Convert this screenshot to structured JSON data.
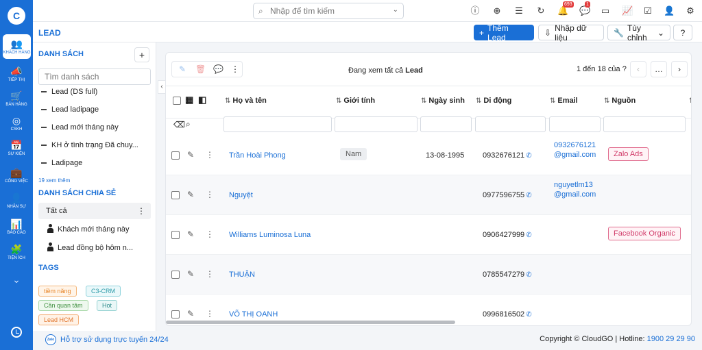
{
  "app": {
    "logo_letter": "C"
  },
  "rail": [
    {
      "label": "KHÁCH HÀNG",
      "icon": "👥"
    },
    {
      "label": "TIẾP THỊ",
      "icon": "📣"
    },
    {
      "label": "BÁN HÀNG",
      "icon": "🛒"
    },
    {
      "label": "CSKH",
      "icon": "◎"
    },
    {
      "label": "SỰ KIỆN",
      "icon": "📅"
    },
    {
      "label": "CÔNG VIỆC",
      "icon": "💼"
    },
    {
      "label": "NHÂN SỰ",
      "icon": "👤"
    },
    {
      "label": "BÁO CÁO",
      "icon": "📊"
    },
    {
      "label": "TIỆN ÍCH",
      "icon": "🧩"
    }
  ],
  "topbar": {
    "search_placeholder": "Nhập để tìm kiếm",
    "notifications_count": "693",
    "messages_count": "1"
  },
  "header": {
    "title": "LEAD",
    "add_button": "Thêm Lead",
    "import_button": "Nhập dữ liệu",
    "customize_button": "Tùy chỉnh"
  },
  "sidebar": {
    "list_title": "DANH SÁCH",
    "list_search_placeholder": "Tìm danh sách",
    "lists": [
      "Lead (DS full)",
      "Lead ladipage",
      "Lead mới tháng này",
      "KH ở tình trạng Đã chuy...",
      "Ladipage"
    ],
    "view_more": "19 xem thêm",
    "shared_title": "DANH SÁCH CHIA SẺ",
    "shared_all": "Tất cả",
    "shared_items": [
      "Khách mới tháng này",
      "Lead đồng bộ hôm n..."
    ],
    "tags_title": "TAGS",
    "tags": [
      {
        "label": "tiềm năng",
        "color": "#e8862a",
        "bg": "#fff4e8",
        "border": "#f4b77a"
      },
      {
        "label": "C3-CRM",
        "color": "#2b9aa8",
        "bg": "#eaf8fa",
        "border": "#8fd3dc"
      },
      {
        "label": "Cần quan tâm",
        "color": "#3f8f3f",
        "bg": "#eef8ee",
        "border": "#a7d8a7"
      },
      {
        "label": "Hot",
        "color": "#2b8a8a",
        "bg": "#eaf7f7",
        "border": "#95d2d2"
      },
      {
        "label": "Lead HCM",
        "color": "#e0732a",
        "bg": "#fff2e6",
        "border": "#f4b27e"
      }
    ]
  },
  "table": {
    "viewing_prefix": "Đang xem tất cả",
    "viewing_entity": "Lead",
    "pagination": "1 đến 18 của",
    "pagination_unknown": "?",
    "columns": [
      "Họ và tên",
      "Giới tính",
      "Ngày sinh",
      "Di động",
      "Email",
      "Nguồn"
    ],
    "rows": [
      {
        "name": "Trần Hoài Phong",
        "gender": "Nam",
        "dob": "13-08-1995",
        "mobile": "0932676121",
        "email": "0932676121@gmail.com",
        "source": "Zalo Ads"
      },
      {
        "name": "Nguyệt",
        "gender": "",
        "dob": "",
        "mobile": "0977596755",
        "email": "nguyetlm13@gmail.com",
        "source": ""
      },
      {
        "name": "Williams Luminosa Luna",
        "gender": "",
        "dob": "",
        "mobile": "0906427999",
        "email": "",
        "source": "Facebook Organic"
      },
      {
        "name": "THUẬN",
        "gender": "",
        "dob": "",
        "mobile": "0785547279",
        "email": "",
        "source": ""
      },
      {
        "name": "VÕ THỊ OANH",
        "gender": "",
        "dob": "",
        "mobile": "0996816502",
        "email": "",
        "source": ""
      }
    ]
  },
  "footer": {
    "support": "Hỗ trợ sử dụng trực tuyến 24/24",
    "zalo": "Zalo",
    "copyright": "Copyright © CloudGO | Hotline: ",
    "hotline": "1900 29 29 90"
  }
}
